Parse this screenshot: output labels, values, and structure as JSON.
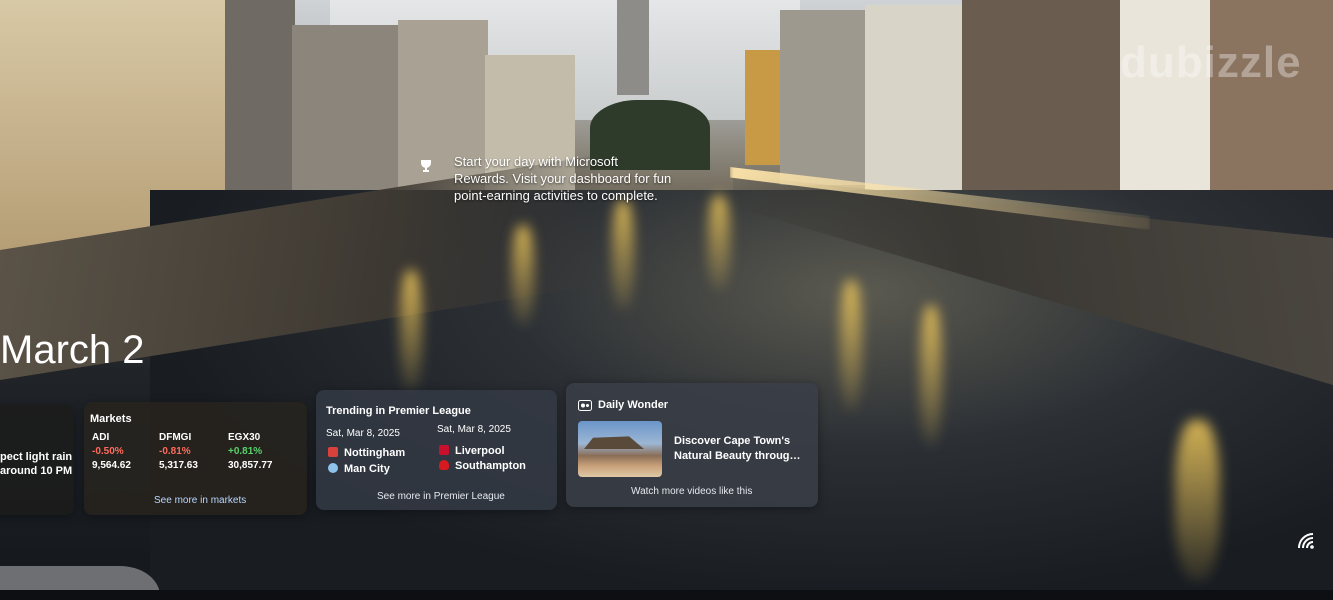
{
  "tip": {
    "text": "Start your day with Microsoft Rewards. Visit your dashboard for fun point-earning activities to complete."
  },
  "watermark": "dubizzle",
  "date": "March 2",
  "weather": {
    "line1": "pect light rain",
    "line2": "around 10 PM"
  },
  "markets": {
    "title": "Markets",
    "link": "See more in markets",
    "items": [
      {
        "symbol": "ADI",
        "change": "-0.50%",
        "price": "9,564.62",
        "dir": "neg"
      },
      {
        "symbol": "DFMGI",
        "change": "-0.81%",
        "price": "5,317.63",
        "dir": "neg"
      },
      {
        "symbol": "EGX30",
        "change": "+0.81%",
        "price": "30,857.77",
        "dir": "pos"
      }
    ]
  },
  "premier_league": {
    "title": "Trending in Premier League",
    "link": "See more in Premier League",
    "matches": [
      {
        "date": "Sat, Mar 8, 2025",
        "home": "Nottingham",
        "away": "Man City",
        "home_color": "#d9423a",
        "away_color": "#8fc3ea"
      },
      {
        "date": "Sat, Mar 8, 2025",
        "home": "Liverpool",
        "away": "Southampton",
        "home_color": "#c8102e",
        "away_color": "#d71920"
      }
    ]
  },
  "daily_wonder": {
    "title": "Daily Wonder",
    "headline": "Discover Cape Town's Natural Beauty throug…",
    "link": "Watch more videos like this"
  },
  "icons": [
    "rewards-trophy-icon",
    "daily-wonder-icon",
    "wifi-icon"
  ]
}
